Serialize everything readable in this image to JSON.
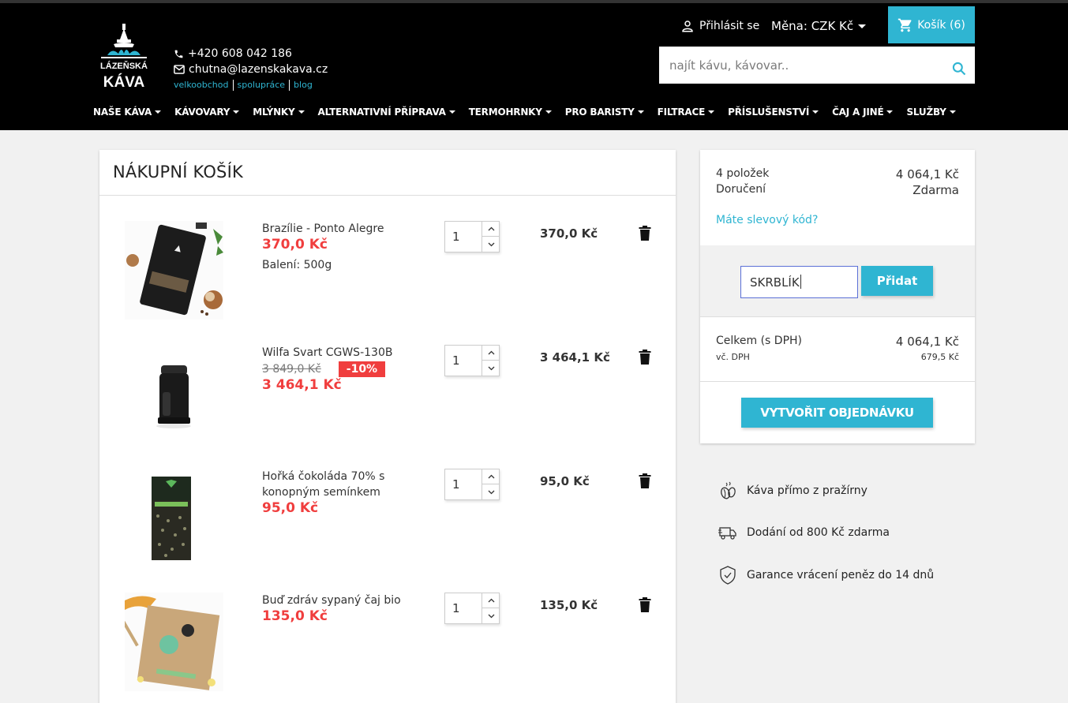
{
  "header": {
    "logo_line1": "LÁZEŇSKÁ",
    "logo_line2": "KÁVA",
    "phone": "+420 608 042 186",
    "email": "chutna@lazenskakava.cz",
    "links": [
      "velkoobchod",
      "spolupráce",
      "blog"
    ],
    "login_label": "Přihlásit se",
    "currency_label": "Měna: CZK Kč",
    "cart_label": "Košík (6)",
    "search_placeholder": "najít kávu, kávovar.."
  },
  "nav": [
    "NAŠE KÁVA",
    "KÁVOVARY",
    "MLÝNKY",
    "ALTERNATIVNÍ PŘÍPRAVA",
    "TERMOHRNKY",
    "PRO BARISTY",
    "FILTRACE",
    "PŘÍSLUŠENSTVÍ",
    "ČAJ A JINÉ",
    "SLUŽBY"
  ],
  "cart": {
    "title": "NÁKUPNÍ KOŠÍK",
    "lines": [
      {
        "name": "Brazílie - Ponto Alegre",
        "price": "370,0 Kč",
        "attr": "Balení: 500g",
        "qty": "1",
        "total": "370,0 Kč"
      },
      {
        "name": "Wilfa Svart CGWS-130B",
        "old_price": "3 849,0 Kč",
        "discount": "-10%",
        "price": "3 464,1 Kč",
        "qty": "1",
        "total": "3 464,1 Kč"
      },
      {
        "name": "Hořká čokoláda 70% s konopným semínkem",
        "price": "95,0 Kč",
        "qty": "1",
        "total": "95,0 Kč"
      },
      {
        "name": "Buď zdráv sypaný čaj bio",
        "price": "135,0 Kč",
        "qty": "1",
        "total": "135,0 Kč"
      }
    ]
  },
  "summary": {
    "items_label": "4 položek",
    "items_value": "4 064,1 Kč",
    "shipping_label": "Doručení",
    "shipping_value": "Zdarma",
    "promo_link": "Máte slevový kód?",
    "promo_value": "SKRBLÍK",
    "promo_button": "Přidat",
    "total_label": "Celkem (s DPH)",
    "total_value": "4 064,1 Kč",
    "tax_label": "vč. DPH",
    "tax_value": "679,5 Kč",
    "checkout_label": "VYTVOŘIT OBJEDNÁVKU"
  },
  "reassurance": [
    {
      "icon": "coffee-beans-icon",
      "text": "Káva přímo z pražírny"
    },
    {
      "icon": "delivery-truck-icon",
      "text": "Dodání od 800 Kč zdarma"
    },
    {
      "icon": "shield-check-icon",
      "text": "Garance vrácení peněz do 14 dnů"
    }
  ],
  "colors": {
    "accent": "#2fb5d2",
    "price_red": "#f03e3e",
    "header_bg": "#000000",
    "page_bg": "#f1f1f1"
  }
}
